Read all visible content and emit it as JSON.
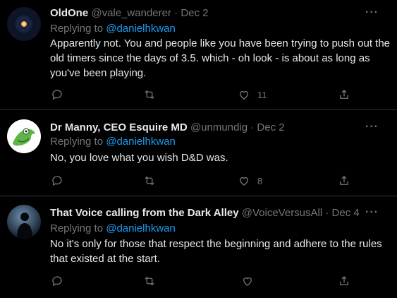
{
  "tweets": [
    {
      "name": "OldOne",
      "handle": "@vale_wanderer",
      "separator": "·",
      "date": "Dec 2",
      "replying_prefix": "Replying to",
      "replying_to": "@danielhkwan",
      "body": "Apparently not.  You and people like you have been trying to push out the old timers since the days of 3.5.  which - oh look - is about as long as you've been playing.",
      "likes": "11",
      "avatar_icon": "ember-on-dark-avatar"
    },
    {
      "name": "Dr Manny, CEO Esquire MD",
      "handle": "@unmundig",
      "separator": "·",
      "date": "Dec 2",
      "replying_prefix": "Replying to",
      "replying_to": "@danielhkwan",
      "body": "No, you love what you wish D&D was.",
      "likes": "8",
      "avatar_icon": "green-frog-avatar"
    },
    {
      "name": "That Voice calling from the Dark Alley",
      "handle": "@VoiceVersusAll",
      "separator": "·",
      "date": "Dec 4",
      "replying_prefix": "Replying to",
      "replying_to": "@danielhkwan",
      "body": "No it's only for those that respect the beginning and adhere to the rules that existed at the start.",
      "likes": "",
      "avatar_icon": "silhouette-avatar"
    }
  ],
  "colors": {
    "background": "#000000",
    "text": "#e7e9ea",
    "muted": "#71767b",
    "link": "#1d9bf0",
    "divider": "#2f3336"
  },
  "icons": [
    "reply-icon",
    "retweet-icon",
    "like-icon",
    "share-icon",
    "more-icon"
  ]
}
